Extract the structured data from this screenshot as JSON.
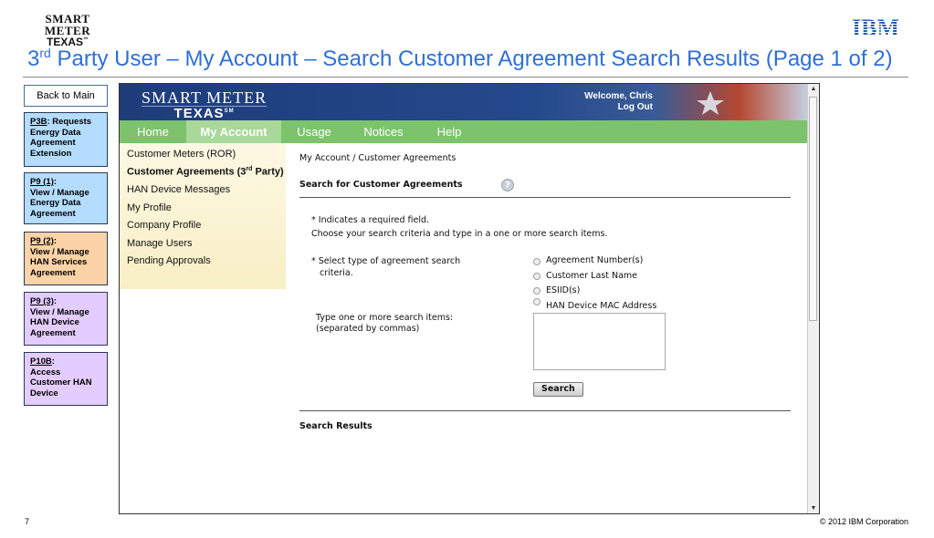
{
  "slide": {
    "logo_line1": "SMART METER",
    "logo_line2": "TEXAS",
    "logo_tm": "™",
    "ibm_logo": "IBM",
    "title_prefix": "3",
    "title_sup": "rd",
    "title_rest": " Party User – My Account – Search Customer Agreement Search Results (Page 1 of 2)",
    "page_number": "7",
    "copyright": "© 2012 IBM Corporation"
  },
  "sidebar_links": {
    "back": "Back to Main",
    "boxes": [
      {
        "code": "P3B",
        "suffix": ": Requests",
        "text": "Energy Data Agreement Extension"
      },
      {
        "code": "P9 (1)",
        "suffix": ":",
        "text": "View / Manage Energy Data Agreement"
      },
      {
        "code": "P9 (2)",
        "suffix": ":",
        "text": "View / Manage HAN Services Agreement"
      },
      {
        "code": "P9 (3)",
        "suffix": ":",
        "text": "View / Manage HAN Device Agreement"
      },
      {
        "code": "P10B",
        "suffix": ":",
        "text": "Access Customer HAN Device"
      }
    ]
  },
  "app": {
    "logo_line1": "SMART METER",
    "logo_line2": "TEXAS",
    "logo_tm": "SM",
    "welcome": "Welcome, Chris",
    "logout": "Log Out",
    "tabs": [
      "Home",
      "My Account",
      "Usage",
      "Notices",
      "Help"
    ],
    "active_tab": "My Account",
    "colors": {
      "header": "#1e3c7a",
      "tabbar": "#7cc36c",
      "tab_active": "#a9d89a",
      "link": "#2f6fd6"
    }
  },
  "sidenav": {
    "items": [
      "Customer Meters (ROR)",
      "Customer Agreements (3",
      "HAN Device Messages",
      "My Profile",
      "Company Profile",
      "Manage Users",
      "Pending Approvals"
    ],
    "selected_sup": "rd",
    "selected_tail": " Party)"
  },
  "form": {
    "breadcrumb": "My Account / Customer Agreements",
    "section_title": "Search for Customer Agreements",
    "required_note": "* Indicates a required field.",
    "instructions": "Choose your search criteria and type in a one or more search items.",
    "criteria_label_1": "*  Select type of agreement search",
    "criteria_label_2": "criteria.",
    "radio_options": [
      "Agreement Number(s)",
      "Customer Last Name",
      "ESIID(s)",
      "HAN Device MAC Address"
    ],
    "items_label_1": "Type one or more search items:",
    "items_label_2": "(separated by commas)",
    "search_value": "",
    "search_button": "Search",
    "results_title": "Search Results"
  }
}
